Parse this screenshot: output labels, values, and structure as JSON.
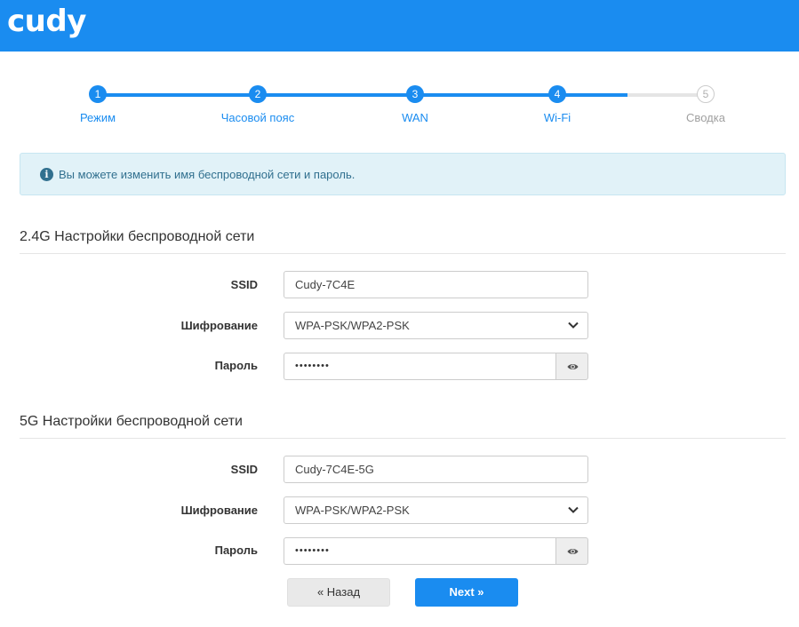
{
  "header": {
    "logo_text": "cudy",
    "brand_color": "#1a8cf0"
  },
  "stepper": {
    "steps": [
      {
        "num": "1",
        "label": "Режим",
        "state": "done"
      },
      {
        "num": "2",
        "label": "Часовой пояс",
        "state": "done"
      },
      {
        "num": "3",
        "label": "WAN",
        "state": "done"
      },
      {
        "num": "4",
        "label": "Wi-Fi",
        "state": "current"
      },
      {
        "num": "5",
        "label": "Сводка",
        "state": "pending"
      }
    ]
  },
  "info": {
    "icon": "info-circle-icon",
    "text": "Вы можете изменить имя беспроводной сети и пароль."
  },
  "sections": [
    {
      "title": "2.4G Настройки беспроводной сети",
      "ssid_label": "SSID",
      "ssid_value": "Cudy-7C4E",
      "encryption_label": "Шифрование",
      "encryption_value": "WPA-PSK/WPA2-PSK",
      "password_label": "Пароль",
      "password_value": "••••••••"
    },
    {
      "title": "5G Настройки беспроводной сети",
      "ssid_label": "SSID",
      "ssid_value": "Cudy-7C4E-5G",
      "encryption_label": "Шифрование",
      "encryption_value": "WPA-PSK/WPA2-PSK",
      "password_label": "Пароль",
      "password_value": "••••••••"
    }
  ],
  "buttons": {
    "back_label": "« Назад",
    "next_label": "Next »"
  }
}
